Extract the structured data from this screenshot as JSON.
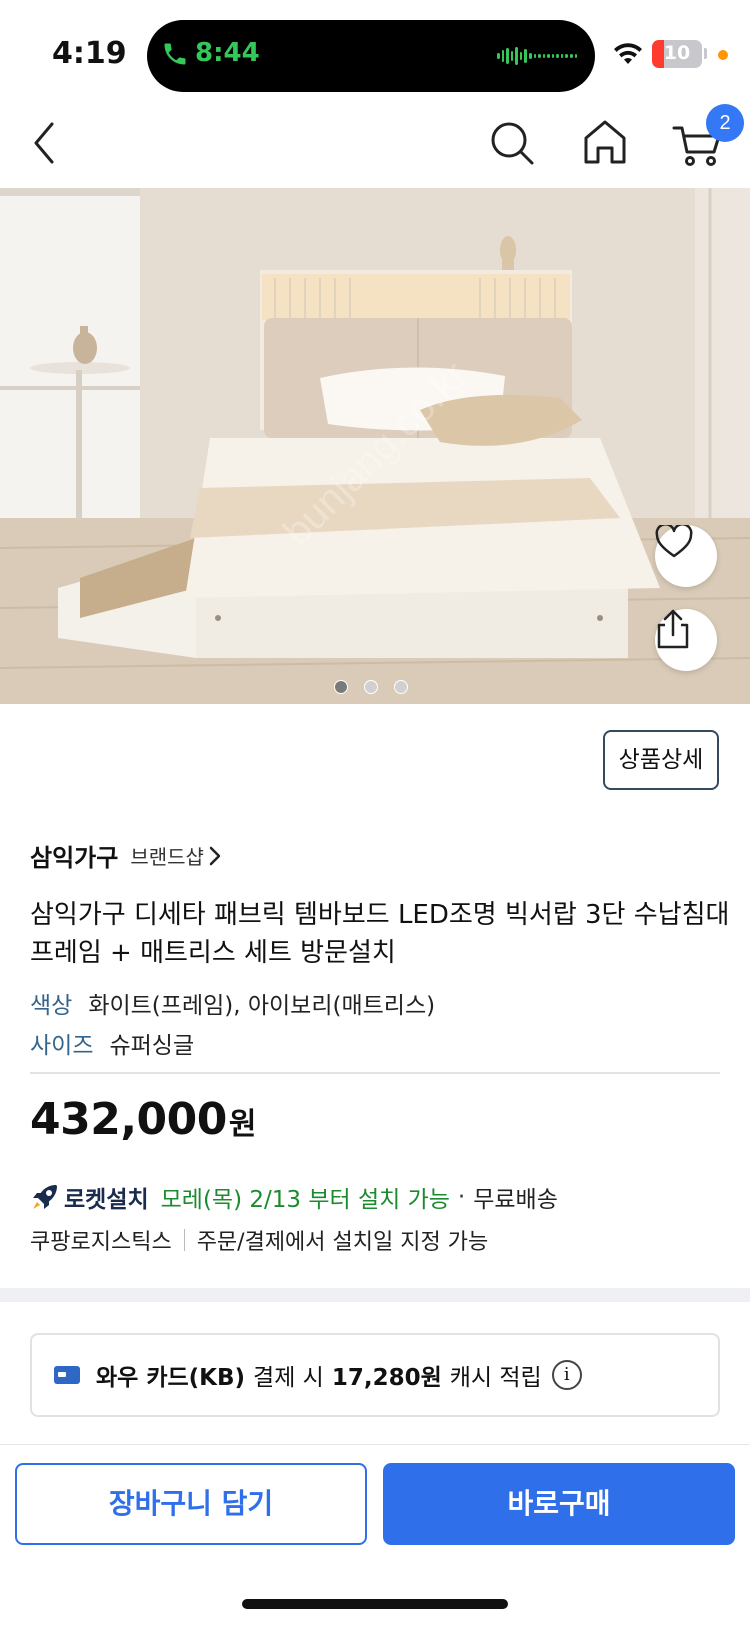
{
  "status_bar": {
    "time": "4:19",
    "call_timer": "8:44",
    "battery_level": "10",
    "call_color": "#34c759"
  },
  "nav": {
    "cart_count": "2",
    "accent": "#3478f6"
  },
  "gallery": {
    "image_count": 3,
    "active_index": 0
  },
  "product": {
    "details_button": "상품상세",
    "brand_name": "삼익가구",
    "brand_shop_link": "브랜드샵",
    "title": "삼익가구 디세타 패브릭 템바보드 LED조명 빅서랍 3단 수납침대 프레임 + 매트리스 세트 방문설치",
    "options": {
      "color_label": "색상",
      "color_value": "화이트(프레임), 아이보리(매트리스)",
      "size_label": "사이즈",
      "size_value": "슈퍼싱글"
    },
    "price": "432,000",
    "price_unit": "원"
  },
  "shipping": {
    "rocket_label": "로켓설치",
    "delivery_date": "모레(목) 2/13 부터 설치 가능",
    "separator": "·",
    "free_shipping": "무료배송",
    "logistics": "쿠팡로지스틱스",
    "install_note": "주문/결제에서 설치일 지정 가능"
  },
  "card_promo": {
    "card_name": "와우 카드(KB)",
    "text_mid": "결제 시",
    "cashback": "17,280원",
    "text_end": "캐시 적립",
    "info_glyph": "i"
  },
  "actions": {
    "add_to_cart": "장바구니 담기",
    "buy_now": "바로구매",
    "primary_color": "#2f6fe9"
  }
}
